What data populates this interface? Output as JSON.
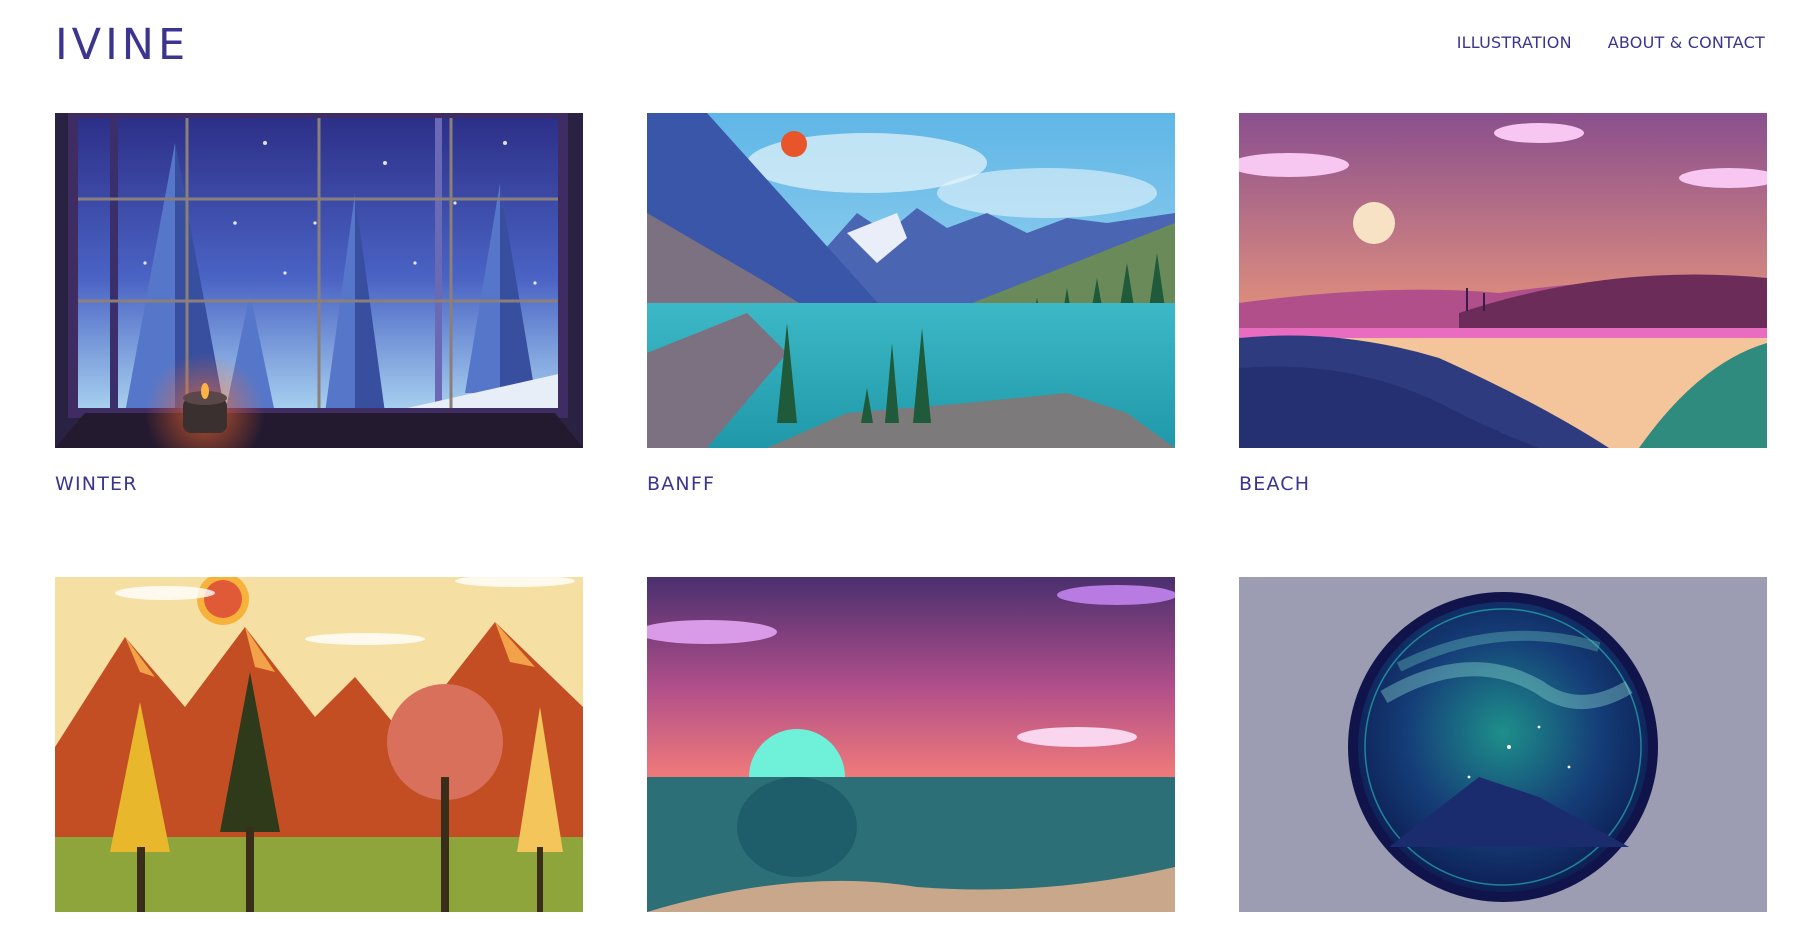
{
  "site": {
    "logo": "IVINE"
  },
  "nav": {
    "items": [
      {
        "label": "ILLUSTRATION"
      },
      {
        "label": "ABOUT & CONTACT"
      }
    ]
  },
  "gallery": {
    "items": [
      {
        "title": "WINTER"
      },
      {
        "title": "BANFF"
      },
      {
        "title": "BEACH"
      },
      {
        "title": ""
      },
      {
        "title": ""
      },
      {
        "title": ""
      }
    ]
  }
}
